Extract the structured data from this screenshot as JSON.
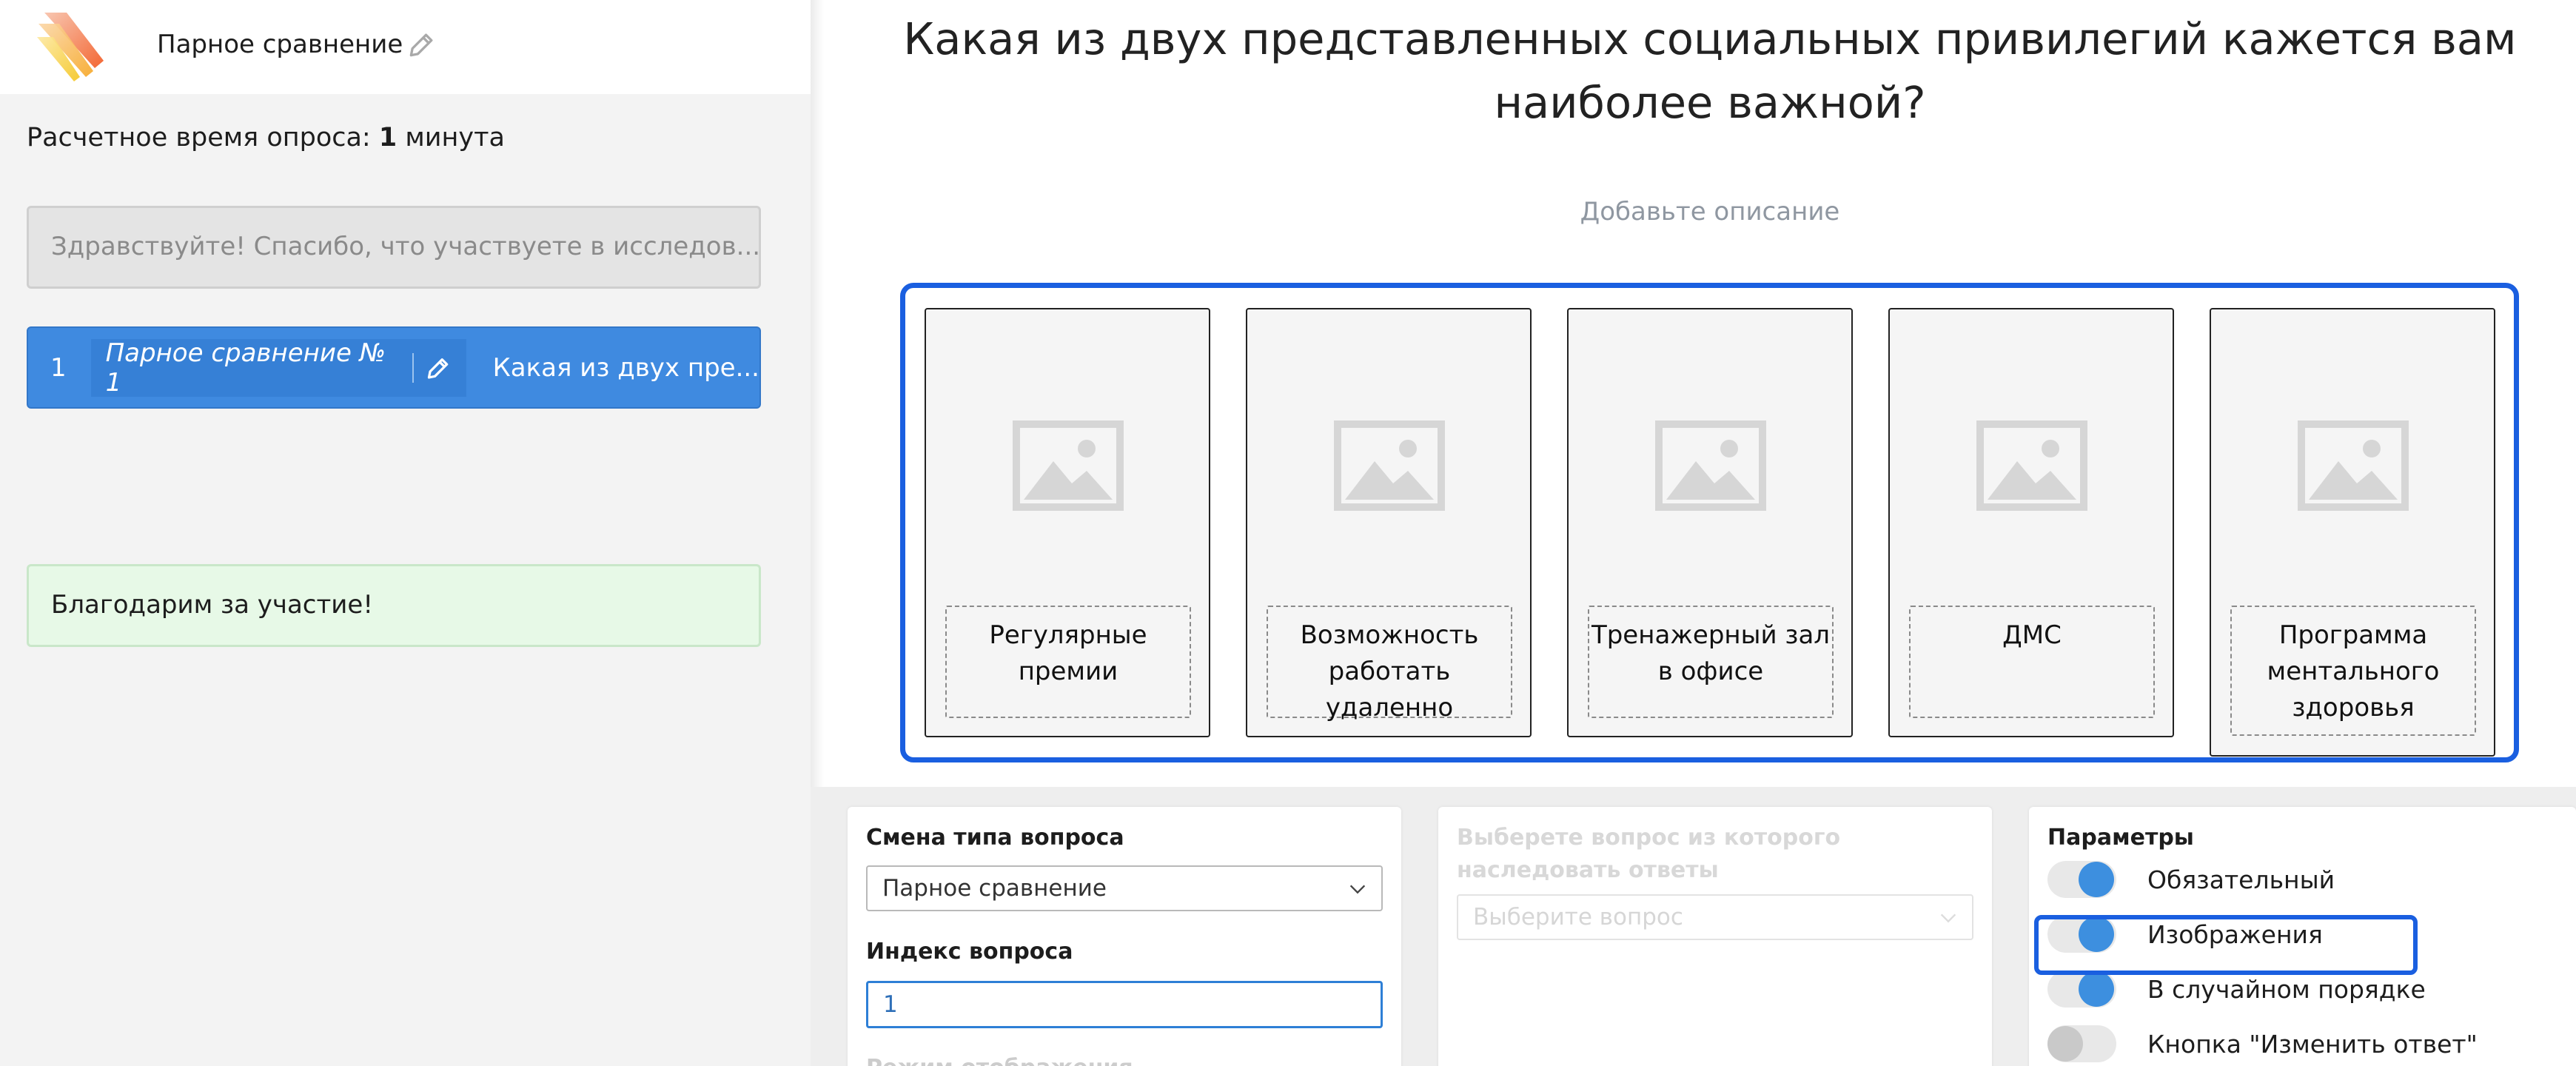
{
  "sidebar": {
    "survey_name": "Парное сравнение",
    "estimated_time_prefix": "Расчетное время опроса: ",
    "estimated_time_value": "1",
    "estimated_time_unit": " минута",
    "welcome_text": "Здравствуйте! Спасибо, что участвуете в исследов...",
    "question": {
      "index": "1",
      "type_label": "Парное сравнение № 1",
      "title": "Какая из двух пре..."
    },
    "thanks_text": "Благодарим за участие!"
  },
  "main": {
    "question_heading": "Какая из двух представленных социальных привилегий кажется вам наиболее важной?",
    "description_placeholder": "Добавьте описание",
    "options": [
      "Регулярные премии",
      "Возможность работать удаленно",
      "Тренажерный зал в офисе",
      "ДМС",
      "Программа ментального здоровья"
    ]
  },
  "settings": {
    "type_panel": {
      "title": "Смена типа вопроса",
      "selected_type": "Парное сравнение",
      "index_label": "Индекс вопроса",
      "index_value": "1",
      "faded_label": "Режим отображения"
    },
    "inherit_panel": {
      "title": "Выберете вопрос из которого наследовать ответы",
      "select_placeholder": "Выберите вопрос"
    },
    "params_panel": {
      "title": "Параметры",
      "toggles": [
        {
          "label": "Обязательный",
          "on": true
        },
        {
          "label": "Изображения",
          "on": true
        },
        {
          "label": "В случайном порядке",
          "on": true
        },
        {
          "label": "Кнопка \"Изменить ответ\"",
          "on": false
        }
      ]
    }
  },
  "colors": {
    "accent_blue": "#3f8ae0",
    "highlight_blue": "#1a5fe0",
    "toggle_on": "#3d8fdf",
    "thanks_bg": "#e7f9e7"
  }
}
